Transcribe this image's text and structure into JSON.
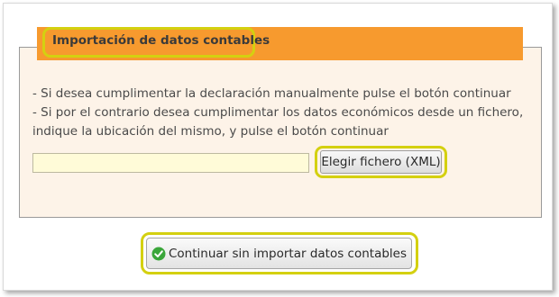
{
  "section": {
    "title": "Importación de datos contables",
    "instructions": [
      "- Si desea cumplimentar la declaración manualmente pulse el botón continuar",
      "- Si por el contrario desea cumplimentar los datos económicos desde un fichero,",
      "indique la ubicación del mismo, y pulse el botón continuar"
    ]
  },
  "file_input": {
    "value": "",
    "choose_button_label": "Elegir fichero (XML)"
  },
  "continue_button": {
    "label": "Continuar sin importar datos contables",
    "icon": "check-circle-icon"
  },
  "colors": {
    "header_orange": "#f79a2e",
    "panel_background": "#fdf3e8",
    "highlight_yellow": "#d4d010",
    "input_background": "#fffbd8",
    "check_green": "#3aa63a"
  }
}
